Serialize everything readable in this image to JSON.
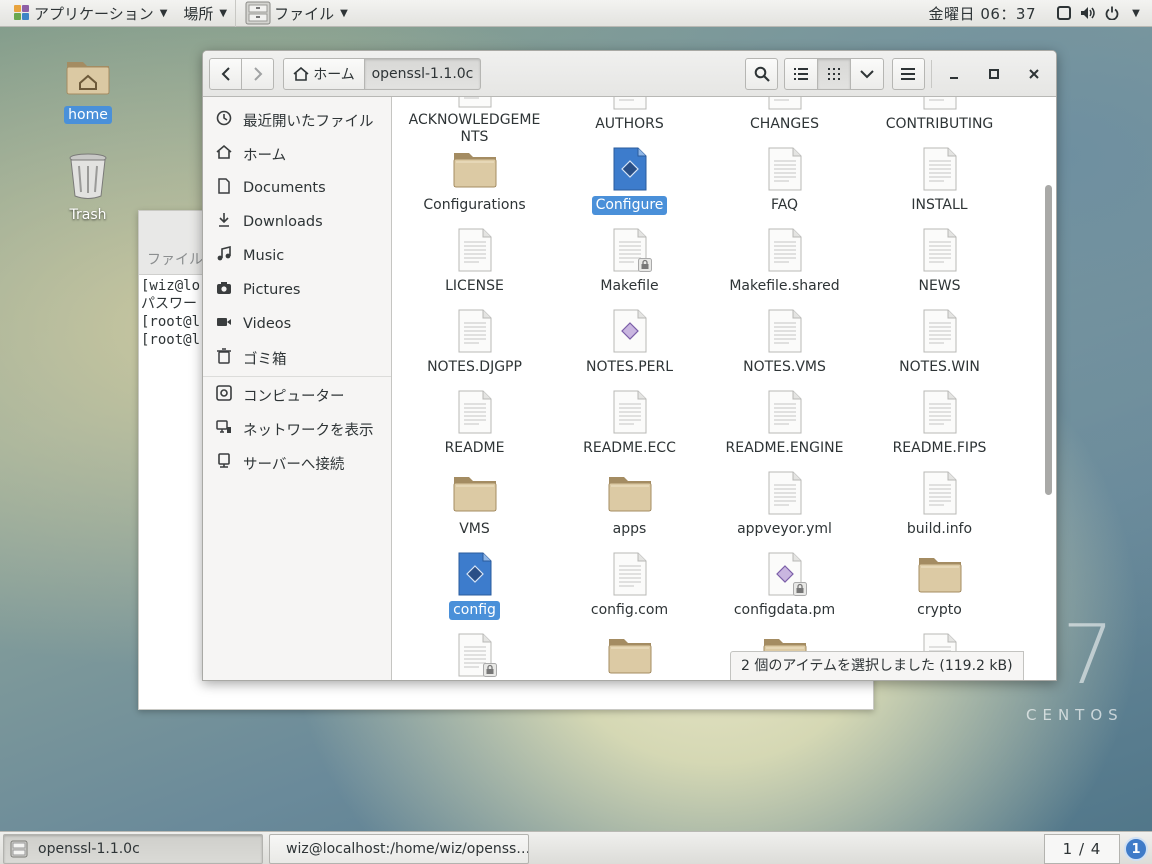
{
  "top_panel": {
    "applications_label": "アプリケーション",
    "places_label": "場所",
    "files_label": "ファイル",
    "clock": "金曜日 06：37"
  },
  "desktop": {
    "home_label": "home",
    "trash_label": "Trash"
  },
  "terminal": {
    "menu_label": "ファイル",
    "lines": [
      "[wiz@lo",
      "パスワー",
      "[root@l",
      "[root@l"
    ]
  },
  "file_manager": {
    "path": {
      "home_label": "ホーム",
      "current_folder": "openssl-1.1.0c"
    },
    "sidebar": [
      {
        "label": "最近開いたファイル",
        "icon": "clock-icon"
      },
      {
        "label": "ホーム",
        "icon": "home-icon"
      },
      {
        "label": "Documents",
        "icon": "document-icon"
      },
      {
        "label": "Downloads",
        "icon": "download-icon"
      },
      {
        "label": "Music",
        "icon": "music-icon"
      },
      {
        "label": "Pictures",
        "icon": "camera-icon"
      },
      {
        "label": "Videos",
        "icon": "video-icon"
      },
      {
        "label": "ゴミ箱",
        "icon": "trash-icon"
      },
      {
        "label": "コンピューター",
        "icon": "drive-icon"
      },
      {
        "label": "ネットワークを表示",
        "icon": "network-icon"
      },
      {
        "label": "サーバーへ接続",
        "icon": "server-icon"
      }
    ],
    "files": [
      {
        "name": "ACKNOWLEDGEMENTS",
        "type": "text"
      },
      {
        "name": "AUTHORS",
        "type": "text"
      },
      {
        "name": "CHANGES",
        "type": "text"
      },
      {
        "name": "CONTRIBUTING",
        "type": "text"
      },
      {
        "name": "Configurations",
        "type": "folder"
      },
      {
        "name": "Configure",
        "type": "script-selected"
      },
      {
        "name": "FAQ",
        "type": "text"
      },
      {
        "name": "INSTALL",
        "type": "text"
      },
      {
        "name": "LICENSE",
        "type": "text"
      },
      {
        "name": "Makefile",
        "type": "locked"
      },
      {
        "name": "Makefile.shared",
        "type": "text"
      },
      {
        "name": "NEWS",
        "type": "text"
      },
      {
        "name": "NOTES.DJGPP",
        "type": "text"
      },
      {
        "name": "NOTES.PERL",
        "type": "script"
      },
      {
        "name": "NOTES.VMS",
        "type": "text"
      },
      {
        "name": "NOTES.WIN",
        "type": "text"
      },
      {
        "name": "README",
        "type": "text"
      },
      {
        "name": "README.ECC",
        "type": "text"
      },
      {
        "name": "README.ENGINE",
        "type": "text"
      },
      {
        "name": "README.FIPS",
        "type": "text"
      },
      {
        "name": "VMS",
        "type": "folder"
      },
      {
        "name": "apps",
        "type": "folder"
      },
      {
        "name": "appveyor.yml",
        "type": "text"
      },
      {
        "name": "build.info",
        "type": "text"
      },
      {
        "name": "config",
        "type": "script-selected"
      },
      {
        "name": "config.com",
        "type": "text"
      },
      {
        "name": "configdata.pm",
        "type": "script-locked"
      },
      {
        "name": "crypto",
        "type": "folder"
      },
      {
        "name": "",
        "type": "locked"
      },
      {
        "name": "",
        "type": "folder"
      },
      {
        "name": "",
        "type": "folder"
      },
      {
        "name": "",
        "type": "text"
      }
    ],
    "status": "2 個のアイテムを選択しました (119.2 kB)"
  },
  "branding": {
    "number": "7",
    "word": "CENTOS"
  },
  "taskbar": {
    "tasks": [
      {
        "label": "openssl-1.1.0c"
      },
      {
        "label": "wiz@localhost:/home/wiz/openss…"
      }
    ],
    "workspace": "1 / 4",
    "notification_count": "1"
  },
  "colors": {
    "selection": "#4a90d9",
    "folder": "#d8c8a4",
    "script_blue": "#3d7ccc"
  }
}
